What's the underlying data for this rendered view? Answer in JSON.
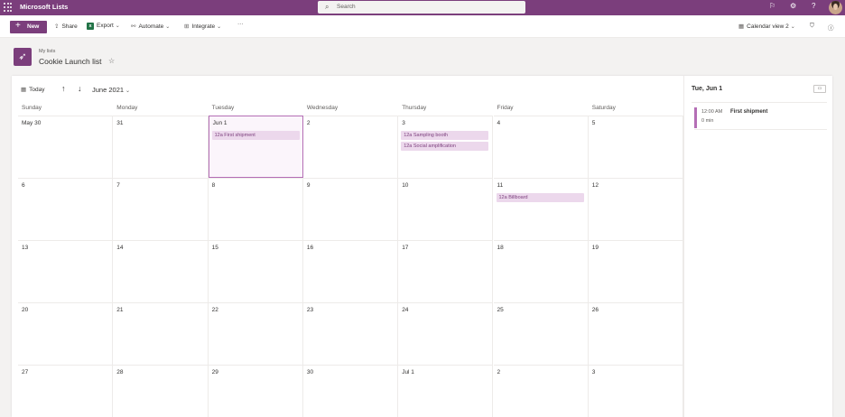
{
  "suite": {
    "app_name": "Microsoft Lists",
    "search_placeholder": "Search"
  },
  "commands": {
    "new_label": "New",
    "share_label": "Share",
    "export_label": "Export",
    "automate_label": "Automate",
    "integrate_label": "Integrate",
    "more_label": "···",
    "view_label": "Calendar view 2"
  },
  "header": {
    "breadcrumb": "My lists",
    "title": "Cookie Launch list"
  },
  "calendar": {
    "today_label": "Today",
    "month_label": "June 2021",
    "weekdays": [
      "Sunday",
      "Monday",
      "Tuesday",
      "Wednesday",
      "Thursday",
      "Friday",
      "Saturday"
    ],
    "weeks": [
      [
        {
          "day": "May 30",
          "events": []
        },
        {
          "day": "31",
          "events": []
        },
        {
          "day": "Jun 1",
          "events": [
            "12a First shipment"
          ],
          "selected": true
        },
        {
          "day": "2",
          "events": []
        },
        {
          "day": "3",
          "events": [
            "12a Sampling booth",
            "12a Social amplification"
          ]
        },
        {
          "day": "4",
          "events": []
        },
        {
          "day": "5",
          "events": []
        }
      ],
      [
        {
          "day": "6",
          "events": []
        },
        {
          "day": "7",
          "events": []
        },
        {
          "day": "8",
          "events": []
        },
        {
          "day": "9",
          "events": []
        },
        {
          "day": "10",
          "events": []
        },
        {
          "day": "11",
          "events": [
            "12a Billboard"
          ]
        },
        {
          "day": "12",
          "events": []
        }
      ],
      [
        {
          "day": "13",
          "events": []
        },
        {
          "day": "14",
          "events": []
        },
        {
          "day": "15",
          "events": []
        },
        {
          "day": "16",
          "events": []
        },
        {
          "day": "17",
          "events": []
        },
        {
          "day": "18",
          "events": []
        },
        {
          "day": "19",
          "events": []
        }
      ],
      [
        {
          "day": "20",
          "events": []
        },
        {
          "day": "21",
          "events": []
        },
        {
          "day": "22",
          "events": []
        },
        {
          "day": "23",
          "events": []
        },
        {
          "day": "24",
          "events": []
        },
        {
          "day": "25",
          "events": []
        },
        {
          "day": "26",
          "events": []
        }
      ],
      [
        {
          "day": "27",
          "events": []
        },
        {
          "day": "28",
          "events": []
        },
        {
          "day": "29",
          "events": []
        },
        {
          "day": "30",
          "events": []
        },
        {
          "day": "Jul 1",
          "events": []
        },
        {
          "day": "2",
          "events": []
        },
        {
          "day": "3",
          "events": []
        }
      ]
    ]
  },
  "side_pane": {
    "date_label": "Tue, Jun 1",
    "item": {
      "time": "12:00 AM",
      "title": "First shipment",
      "duration": "0 min"
    }
  },
  "colors": {
    "brand": "#7b3e7c",
    "event_bg": "#ecd8ec",
    "selected_border": "#b46eb5"
  }
}
